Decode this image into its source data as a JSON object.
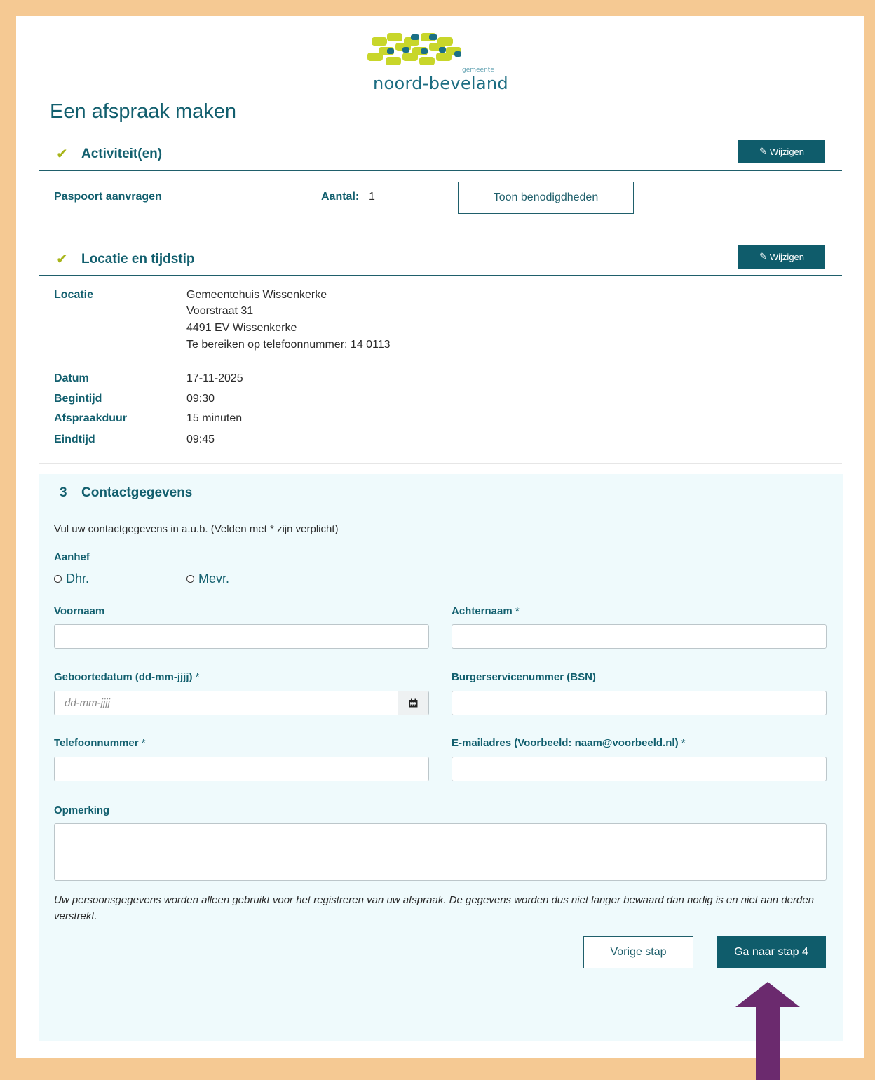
{
  "header": {
    "logo_small": "gemeente",
    "logo_word": "noord-beveland",
    "page_title": "Een afspraak maken"
  },
  "activiteiten": {
    "title": "Activiteit(en)",
    "edit_label": "Wijzigen",
    "product": "Paspoort aanvragen",
    "aantal_label": "Aantal:",
    "aantal_value": "1",
    "requirements_button": "Toon benodigdheden"
  },
  "locatie": {
    "title": "Locatie en tijdstip",
    "edit_label": "Wijzigen",
    "locatie_label": "Locatie",
    "address_lines": [
      "Gemeentehuis Wissenkerke",
      "Voorstraat 31",
      "4491 EV Wissenkerke",
      "Te bereiken op telefoonnummer: 14 0113"
    ],
    "details": [
      {
        "label": "Datum",
        "value": "17-11-2025"
      },
      {
        "label": "Begintijd",
        "value": "09:30"
      },
      {
        "label": "Afspraakduur",
        "value": "15 minuten"
      },
      {
        "label": "Eindtijd",
        "value": "09:45"
      }
    ]
  },
  "contact": {
    "step_number": "3",
    "title": "Contactgegevens",
    "intro": "Vul uw contactgegevens in a.u.b. (Velden met * zijn verplicht)",
    "aanhef_label": "Aanhef",
    "aanhef_options": [
      "Dhr.",
      "Mevr."
    ],
    "fields": {
      "voornaam": {
        "label": "Voornaam",
        "req": ""
      },
      "achternaam": {
        "label": "Achternaam",
        "req": " *"
      },
      "geboortedatum": {
        "label": "Geboortedatum (dd-mm-jjjj)",
        "req": " *",
        "placeholder": "dd-mm-jjjj"
      },
      "bsn": {
        "label": "Burgerservicenummer (BSN)",
        "req": ""
      },
      "telefoon": {
        "label": "Telefoonnummer",
        "req": " *"
      },
      "email": {
        "label": "E-mailadres (Voorbeeld: naam@voorbeeld.nl)",
        "req": " *"
      },
      "opmerking": {
        "label": "Opmerking",
        "req": ""
      }
    },
    "privacy": "Uw persoonsgegevens worden alleen gebruikt voor het registreren van uw afspraak. De gegevens worden dus niet langer bewaard dan nodig is en niet aan derden verstrekt.",
    "prev_button": "Vorige stap",
    "next_button": "Ga naar stap 4"
  },
  "colors": {
    "accent": "#0f5c6b",
    "check": "#a8b51a",
    "frame": "#f5c993",
    "arrow": "#6b2a6e"
  }
}
